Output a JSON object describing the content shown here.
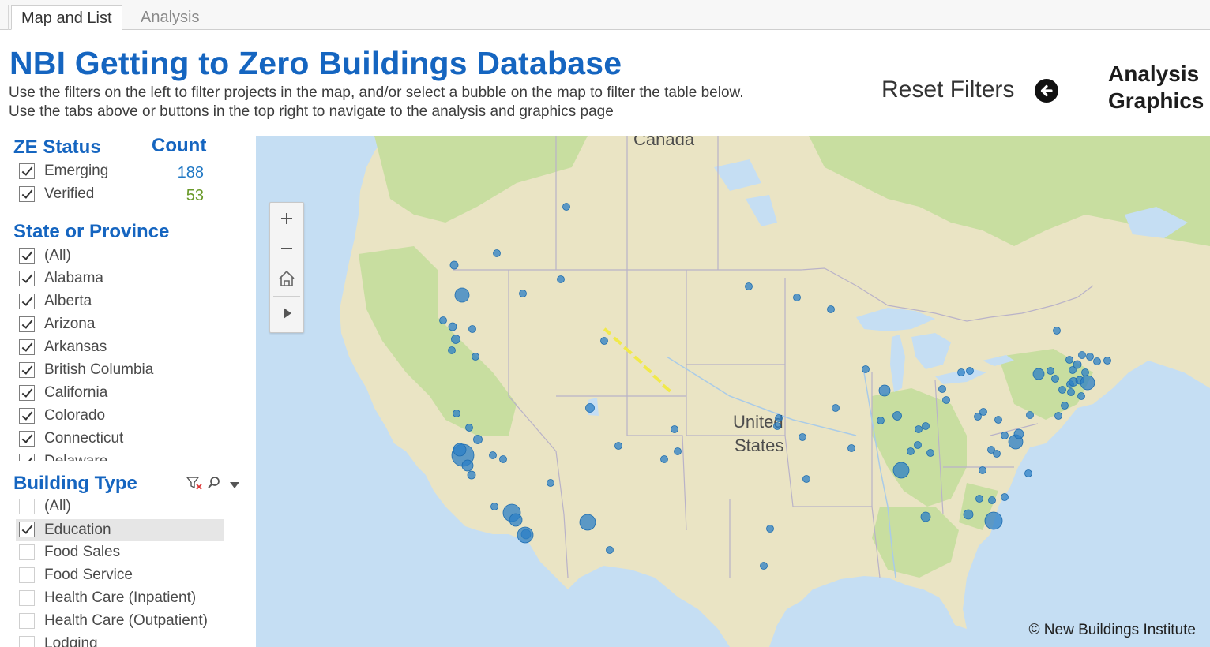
{
  "tabs": [
    {
      "label": "Map and List",
      "active": true
    },
    {
      "label": "Analysis",
      "active": false
    }
  ],
  "title": "NBI Getting to Zero Buildings Database",
  "subtitle_lines": [
    "Use the filters on the left to filter projects in the map, and/or select a bubble on the map to filter the table below.",
    "Use the tabs above or buttons in the top right to navigate to the analysis and graphics page"
  ],
  "reset_filters": {
    "label": "Reset Filters",
    "icon": "arrow-left-circle-icon"
  },
  "nav_links": [
    "Analysis",
    "Graphics"
  ],
  "ze_status": {
    "title": "ZE Status",
    "count_header": "Count",
    "items": [
      {
        "label": "Emerging",
        "checked": true,
        "count": "188",
        "count_color": "#1f77c4"
      },
      {
        "label": "Verified",
        "checked": true,
        "count": "53",
        "count_color": "#6a9a2a"
      }
    ]
  },
  "state_filter": {
    "title": "State or Province",
    "items": [
      {
        "label": "(All)",
        "checked": true
      },
      {
        "label": "Alabama",
        "checked": true
      },
      {
        "label": "Alberta",
        "checked": true
      },
      {
        "label": "Arizona",
        "checked": true
      },
      {
        "label": "Arkansas",
        "checked": true
      },
      {
        "label": "British Columbia",
        "checked": true
      },
      {
        "label": "California",
        "checked": true
      },
      {
        "label": "Colorado",
        "checked": true
      },
      {
        "label": "Connecticut",
        "checked": true
      },
      {
        "label": "Delaware",
        "checked": true
      }
    ]
  },
  "building_type": {
    "title": "Building Type",
    "tools": [
      "clear-filter-icon",
      "search-icon",
      "dropdown-arrow-icon"
    ],
    "items": [
      {
        "label": "(All)",
        "checked": false
      },
      {
        "label": "Education",
        "checked": true,
        "selected": true
      },
      {
        "label": "Food Sales",
        "checked": false
      },
      {
        "label": "Food Service",
        "checked": false
      },
      {
        "label": "Health Care (Inpatient)",
        "checked": false
      },
      {
        "label": "Health Care (Outpatient)",
        "checked": false
      },
      {
        "label": "Lodging",
        "checked": false
      }
    ]
  },
  "map": {
    "labels": {
      "canada": "Canada",
      "us_line1": "United",
      "us_line2": "States"
    },
    "controls": [
      "zoom-in-icon",
      "zoom-out-icon",
      "home-icon",
      "expand-toolbar-icon"
    ],
    "copyright": "© New Buildings Institute",
    "colors": {
      "water": "#c5def3",
      "land": "#eae4c4",
      "forest": "#c8dea0",
      "bubble": "#2b7fc6"
    }
  }
}
